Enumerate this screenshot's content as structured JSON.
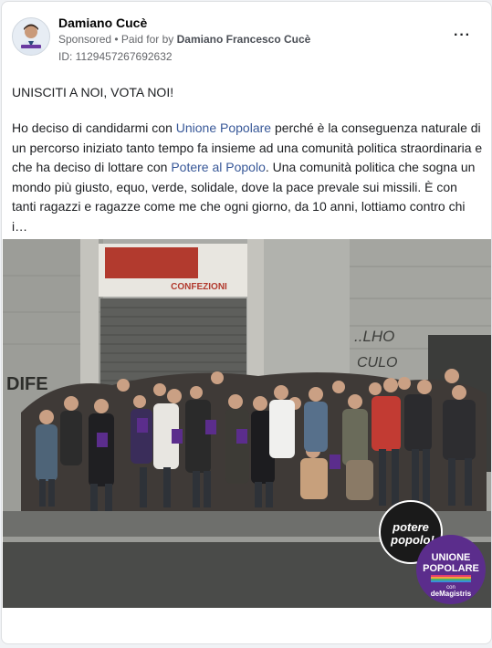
{
  "advertiser": {
    "name": "Damiano Cucè",
    "sponsored_label": "Sponsored",
    "paid_for_prefix": "• Paid for by",
    "payer_name": "Damiano Francesco Cucè",
    "ad_id": "ID: 1129457267692632"
  },
  "menu": {
    "more_label": "···",
    "more_icon": "more-horizontal-icon"
  },
  "post": {
    "headline": "UNISCITI A NOI, VOTA NOI!",
    "body": {
      "p1": "Ho deciso di candidarmi con ",
      "link1": "Unione Popolare",
      "p2": " perché è la conseguenza naturale di un percorso iniziato tanto tempo fa insieme ad una comunità politica straordinaria e che ha deciso di lottare con ",
      "link2": "Potere al Popolo",
      "p3": ". Una comunità politica che sogna un mondo più giusto, equo, verde, solidale, dove la pace prevale sui missili. È con tanti ragazzi e ragazze come me che ogni giorno, da 10 anni, lottiamo contro chi i…"
    }
  },
  "image": {
    "sign_text": "CONFEZIONI",
    "graffiti_1": "..LHO",
    "graffiti_2": "CULO",
    "graffiti_3": "DIFE",
    "potere_logo_1": "potere",
    "potere_logo_2": "popolo!",
    "unione_logo_1": "UNIONE",
    "unione_logo_2": "POPOLARE",
    "unione_logo_3": "con",
    "unione_logo_4": "deMagistris"
  },
  "colors": {
    "link": "#385898",
    "unione_purple": "#5b2d8c",
    "potere_black": "#1a1a1a"
  }
}
